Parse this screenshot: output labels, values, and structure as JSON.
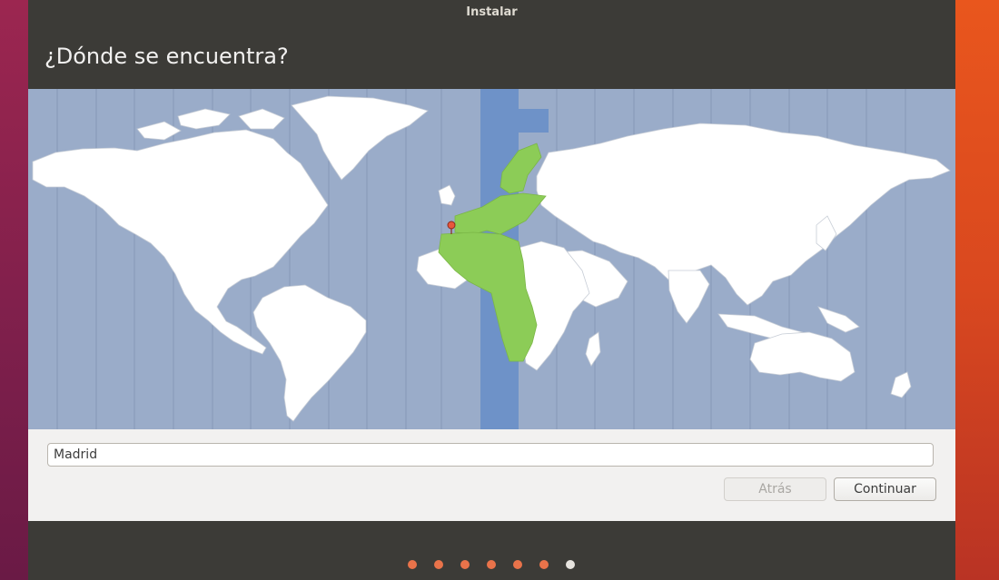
{
  "window": {
    "title": "Instalar"
  },
  "page": {
    "heading": "¿Dónde se encuentra?"
  },
  "map": {
    "highlighted_timezone": "Europe/Madrid",
    "colors": {
      "ocean": "#9aacc9",
      "land": "#ffffff",
      "highlight_land": "#8ccc57",
      "highlight_band": "#6e92c8",
      "borders": "#c7cdd6"
    }
  },
  "location": {
    "value": "Madrid"
  },
  "buttons": {
    "back_label": "Atrás",
    "continue_label": "Continuar"
  },
  "progress": {
    "total_steps": 7,
    "current_step": 7,
    "accent": "#e9734a"
  }
}
